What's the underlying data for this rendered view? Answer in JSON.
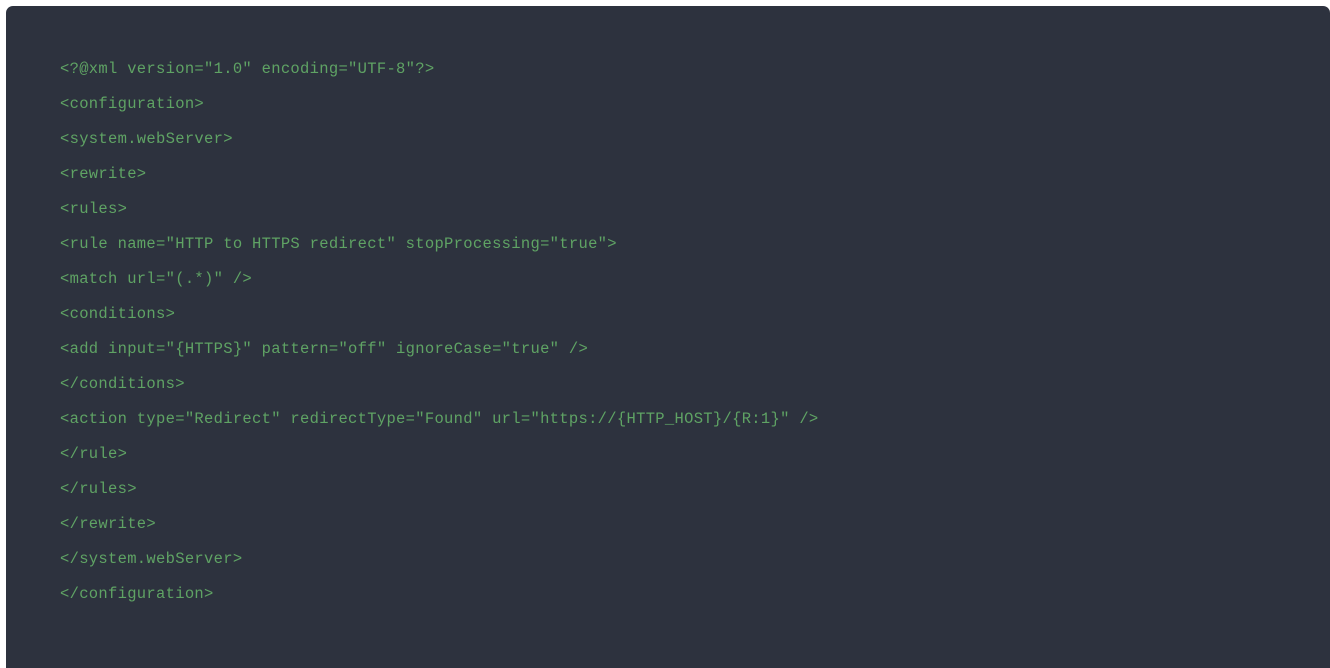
{
  "theme": {
    "page_background": "#ffffff",
    "code_background": "#2d323e",
    "code_text_color": "#5fa364",
    "language": "xml"
  },
  "code_block": {
    "language_label": "xml",
    "lines": [
      "<?@xml version=\"1.0\" encoding=\"UTF-8\"?>",
      "<configuration>",
      "<system.webServer>",
      "<rewrite>",
      "<rules>",
      "<rule name=\"HTTP to HTTPS redirect\" stopProcessing=\"true\">",
      "<match url=\"(.*)\" />",
      "<conditions>",
      "<add input=\"{HTTPS}\" pattern=\"off\" ignoreCase=\"true\" />",
      "</conditions>",
      "<action type=\"Redirect\" redirectType=\"Found\" url=\"https://{HTTP_HOST}/{R:1}\" />",
      "</rule>",
      "</rules>",
      "</rewrite>",
      "</system.webServer>",
      "</configuration>"
    ]
  }
}
